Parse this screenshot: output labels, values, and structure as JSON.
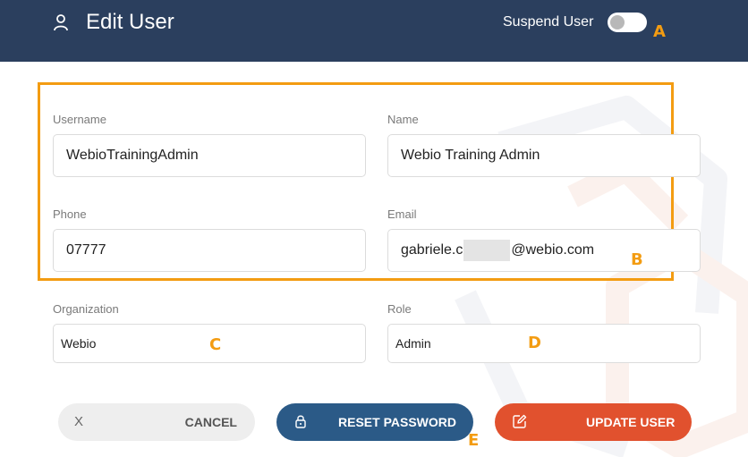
{
  "header": {
    "title": "Edit User",
    "suspend_label": "Suspend User",
    "suspend_on": false
  },
  "annotations": {
    "a": "A",
    "b": "B",
    "c": "C",
    "d": "D",
    "e": "E"
  },
  "form": {
    "username": {
      "label": "Username",
      "value": "WebioTrainingAdmin"
    },
    "name": {
      "label": "Name",
      "value": "Webio Training Admin"
    },
    "phone": {
      "label": "Phone",
      "value": "07777"
    },
    "email": {
      "label": "Email",
      "value_prefix": "gabriele.c",
      "value_suffix": "@webio.com"
    },
    "organization": {
      "label": "Organization",
      "value": "Webio"
    },
    "role": {
      "label": "Role",
      "value": "Admin"
    }
  },
  "actions": {
    "cancel_icon": "X",
    "cancel_label": "CANCEL",
    "reset_label": "RESET PASSWORD",
    "update_label": "UPDATE USER"
  },
  "colors": {
    "header_bg": "#2b3f5e",
    "annotation": "#f39c12",
    "reset_bg": "#2b5a87",
    "update_bg": "#e1512e",
    "cancel_bg": "#eeeeee"
  },
  "icons": {
    "header": "user-icon",
    "reset": "lock-icon",
    "update": "edit-icon"
  }
}
